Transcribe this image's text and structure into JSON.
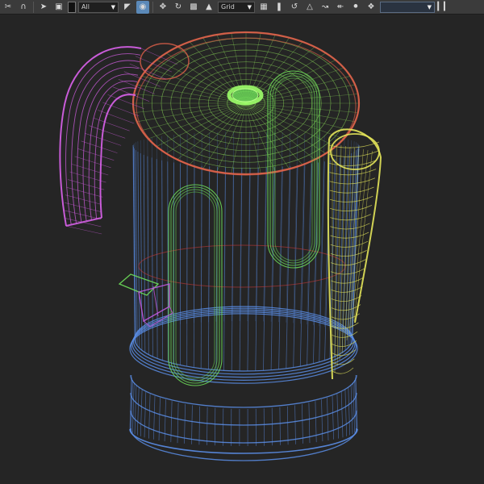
{
  "toolbar": {
    "tools": [
      {
        "name": "edge-tool-icon",
        "glyph": "✂"
      },
      {
        "name": "select-arrow-icon",
        "glyph": "➤"
      },
      {
        "name": "square-select-icon",
        "glyph": "▣"
      },
      {
        "name": "color-swatch-icon",
        "glyph": ""
      }
    ],
    "selection_filter": "All",
    "snap_mode": "Grid",
    "active_tool_icon": "snap-magnet-icon",
    "named_selection_value": "",
    "colors": {
      "toolbar_bg": "#3b3b3b",
      "active": "#5b89b8"
    }
  },
  "viewport": {
    "background": "#252525",
    "wire_colors": {
      "body": "#5b8ee8",
      "lid": "#8fe05a",
      "lid_rim": "#e0604a",
      "handle": "#d35fe3",
      "spout": "#e4e65a",
      "window": "#6ee05a",
      "switch": "#c05adf"
    }
  }
}
